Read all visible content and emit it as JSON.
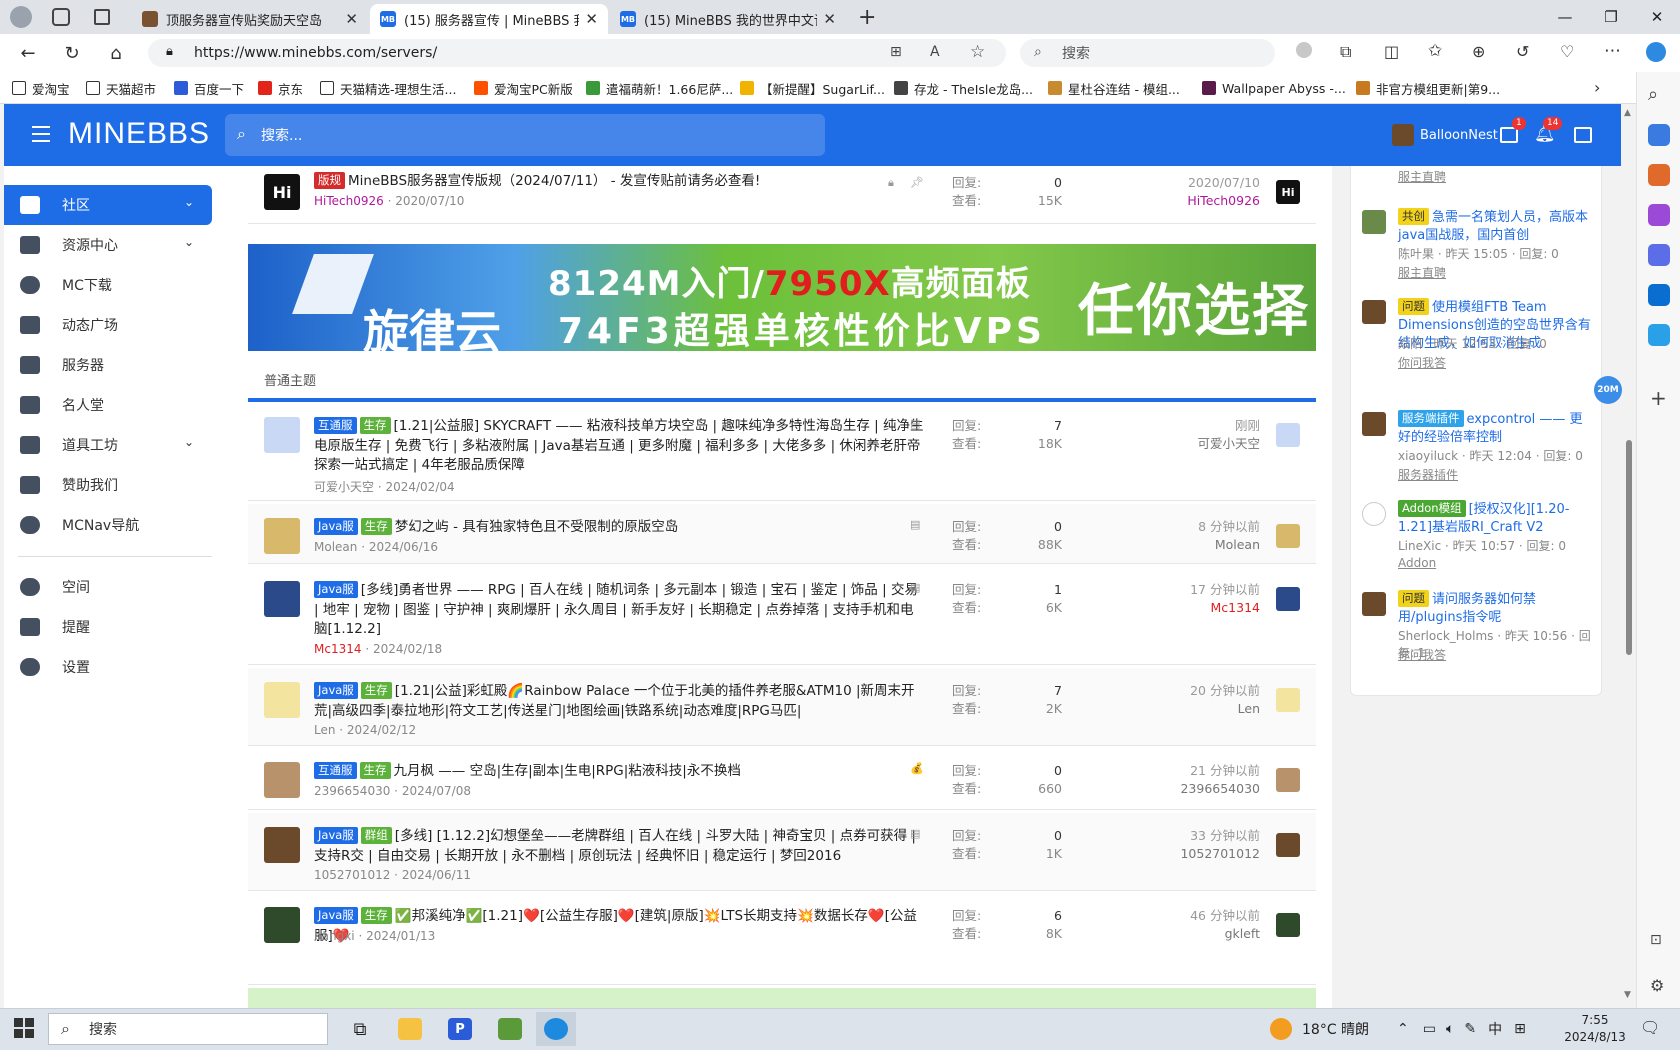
{
  "browser": {
    "tabs": [
      {
        "title": "顶服务器宣传贴奖励天空岛",
        "active": false
      },
      {
        "title": "(15) 服务器宣传 | MineBBS 我的世界中文论坛",
        "active": true
      },
      {
        "title": "(15) MineBBS 我的世界中文论坛",
        "active": false
      }
    ],
    "url": "https://www.minebbs.com/servers/",
    "search_placeholder": "搜索",
    "bookmarks": [
      "爱淘宝",
      "天猫超市",
      "百度一下",
      "京东",
      "天猫精选-理想生活...",
      "爱淘宝PC新版",
      "遣福萌新！1.66尼萨...",
      "【新提醒】SugarLif...",
      "存龙 - TheIsle龙岛...",
      "星杜谷连结 - 模组...",
      "Wallpaper Abyss -...",
      "非官方模组更新|第9..."
    ]
  },
  "site": {
    "logo": "MINEBBS",
    "search_placeholder": "搜索...",
    "username": "BalloonNest",
    "mail_badge": "1",
    "alert_badge": "14"
  },
  "nav": {
    "items": [
      {
        "label": "社区",
        "active": true,
        "chev": "⌄"
      },
      {
        "label": "资源中心",
        "chev": "⌄"
      },
      {
        "label": "MC下载"
      },
      {
        "label": "动态广场"
      },
      {
        "label": "服务器"
      },
      {
        "label": "名人堂"
      },
      {
        "label": "道具工坊",
        "chev": "⌄"
      },
      {
        "label": "赞助我们"
      },
      {
        "label": "MCNav导航"
      }
    ],
    "account": [
      {
        "label": "空间"
      },
      {
        "label": "提醒"
      },
      {
        "label": "设置"
      }
    ]
  },
  "pinned": {
    "tag": "版规",
    "title": "MineBBS服务器宣传版规（2024/07/11） - 发宣传贴前请务必查看!",
    "author": "HiTech0926",
    "date": "2020/07/10",
    "replies_label": "回复:",
    "replies": "0",
    "views_label": "查看:",
    "views": "15K",
    "last_time": "2020/07/10",
    "last_user": "HiTech0926",
    "avatar_text": "Hi"
  },
  "banner": {
    "line1a": "8124M入门/",
    "line1b": "7950X",
    "line1c": "高频面板",
    "line2": "74F3超强单核性价比VPS",
    "brand": "旋律云",
    "slogan": "任你选择"
  },
  "section_label": "普通主题",
  "threads": [
    {
      "tags": [
        [
          "互通服",
          "blue"
        ],
        [
          "生存",
          "green"
        ]
      ],
      "title": "[1.21|公益服] SKYCRAFT —— 粘液科技单方块空岛 | 趣味纯净多特性海岛生存 | 纯净生电原版生存 | 免费飞行 | 多粘液附属 | Java基岩互通 | 更多附魔 | 福利多多 | 大佬多多 | 休闲养老肝帝探索一站式搞定 | 4年老服品质保障",
      "author": "可爱小天空",
      "date": "2024/02/04",
      "replies": "7",
      "views": "18K",
      "last_time": "刚刚",
      "last_user": "可爱小天空",
      "avatar": "#c9d9f5",
      "icon": "▤"
    },
    {
      "tags": [
        [
          "Java服",
          "blue"
        ],
        [
          "生存",
          "green"
        ]
      ],
      "title": "梦幻之屿 - 具有独家特色且不受限制的原版空岛",
      "author": "Molean",
      "date": "2024/06/16",
      "replies": "0",
      "views": "88K",
      "last_time": "8 分钟以前",
      "last_user": "Molean",
      "avatar": "#d8b86a",
      "icon": "▤"
    },
    {
      "tags": [
        [
          "Java服",
          "blue"
        ]
      ],
      "title": "[多线]勇者世界 —— RPG | 百人在线 | 随机词条 | 多元副本 | 锻造 | 宝石 | 鉴定 | 饰品 | 交易 | 地牢 | 宠物 | 图鉴 | 守护神 | 爽刷爆肝 | 永久周目 | 新手友好 | 长期稳定 | 点券掉落 | 支持手机和电脑[1.12.2]",
      "author": "Mc1314",
      "date": "2024/02/18",
      "replies": "1",
      "views": "6K",
      "last_time": "17 分钟以前",
      "last_user": "Mc1314",
      "avatar": "#2a4a8a",
      "icon": "▤",
      "red_user": true
    },
    {
      "tags": [
        [
          "Java服",
          "blue"
        ],
        [
          "生存",
          "green"
        ]
      ],
      "title": "[1.21|公益]彩虹殿🌈Rainbow Palace 一个位于北美的插件养老服&ATM10 |新周末开荒|高级四季|泰拉地形|符文工艺|传送星门|地图绘画|铁路系统|动态难度|RPG马匹|",
      "author": "Len",
      "date": "2024/02/12",
      "replies": "7",
      "views": "2K",
      "last_time": "20 分钟以前",
      "last_user": "Len",
      "avatar": "#f3e4a0",
      "icon": ""
    },
    {
      "tags": [
        [
          "互通服",
          "blue"
        ],
        [
          "生存",
          "green"
        ]
      ],
      "title": "九月枫 —— 空岛|生存|副本|生电|RPG|粘液科技|永不换档",
      "author": "2396654030",
      "date": "2024/07/08",
      "replies": "0",
      "views": "660",
      "last_time": "21 分钟以前",
      "last_user": "2396654030",
      "avatar": "#b8926a",
      "icon": "💰"
    },
    {
      "tags": [
        [
          "Java服",
          "blue"
        ],
        [
          "群组",
          "green"
        ]
      ],
      "title": "[多线] [1.12.2]幻想堡垒——老牌群组 | 百人在线 | 斗罗大陆 | 神奇宝贝 | 点券可获得 | 支持R交 | 自由交易 | 长期开放 | 永不删档 | 原创玩法 | 经典怀旧 | 稳定运行 | 梦回2016",
      "author": "1052701012",
      "date": "2024/06/11",
      "replies": "0",
      "views": "1K",
      "last_time": "33 分钟以前",
      "last_user": "1052701012",
      "avatar": "#6b4a2b",
      "icon": "▤"
    },
    {
      "tags": [
        [
          "Java服",
          "blue"
        ],
        [
          "生存",
          "green"
        ]
      ],
      "title": "✅邦溪纯净✅[1.21]❤️[公益生存服]❤️[建筑|原版]💥LTS长期支持💥数据长存❤️[公益服]❤️",
      "author": "bangxi",
      "date": "2024/01/13",
      "replies": "6",
      "views": "8K",
      "last_time": "46 分钟以前",
      "last_user": "gkleft",
      "avatar": "#2f4a2a",
      "icon": ""
    }
  ],
  "stat_labels": {
    "replies": "回复:",
    "views": "查看:"
  },
  "right_panel": {
    "top_forum": "服主直聘",
    "items": [
      {
        "tag": "共创",
        "tag_style": "yel",
        "title": "急需一名策划人员，高版本java国战服，国内首创",
        "user": "陈叶果",
        "time": "昨天 15:05",
        "reply": "回复: 0",
        "forum": "服主直聘",
        "avatar": "#6a8a4a"
      },
      {
        "tag": "问题",
        "tag_style": "yel",
        "title": "使用模组FTB Team Dimensions创造的空岛世界含有结构生成，如何取消生成",
        "user": "焱阳",
        "time": "昨天 12:53",
        "reply": "回复: 0",
        "forum": "你问我答",
        "avatar": "#6b4a2b"
      },
      {
        "tag": "服务端插件",
        "tag_style": "ltblue",
        "title": "expcontrol —— 更好的经验倍率控制",
        "user": "xiaoyiluck",
        "time": "昨天 12:04",
        "reply": "回复: 0",
        "forum": "服务器插件",
        "avatar": "#6b4a2b"
      },
      {
        "tag": "Addon模组",
        "tag_style": "addon",
        "title": "[授权汉化][1.20-1.21]基岩版RI_Craft V2",
        "user": "LineXic",
        "time": "昨天 10:57",
        "reply": "回复: 0",
        "forum": "Addon",
        "avatar": "#ffffff"
      },
      {
        "tag": "问题",
        "tag_style": "yel",
        "title": "请问服务器如何禁用/plugins指令呢",
        "user": "Sherlock_Holms",
        "time": "昨天 10:56",
        "reply": "回复: 1",
        "forum": "你问我答",
        "avatar": "#6b4a2b"
      }
    ]
  },
  "download_badge": "20M",
  "taskbar": {
    "search": "搜索",
    "weather": "18°C 晴朗",
    "ime": "中",
    "time": "7:55",
    "date": "2024/8/13"
  },
  "colors": {
    "brand": "#1e6ce6",
    "tag_green": "#5cb23a",
    "tag_red": "#d42b2b"
  }
}
